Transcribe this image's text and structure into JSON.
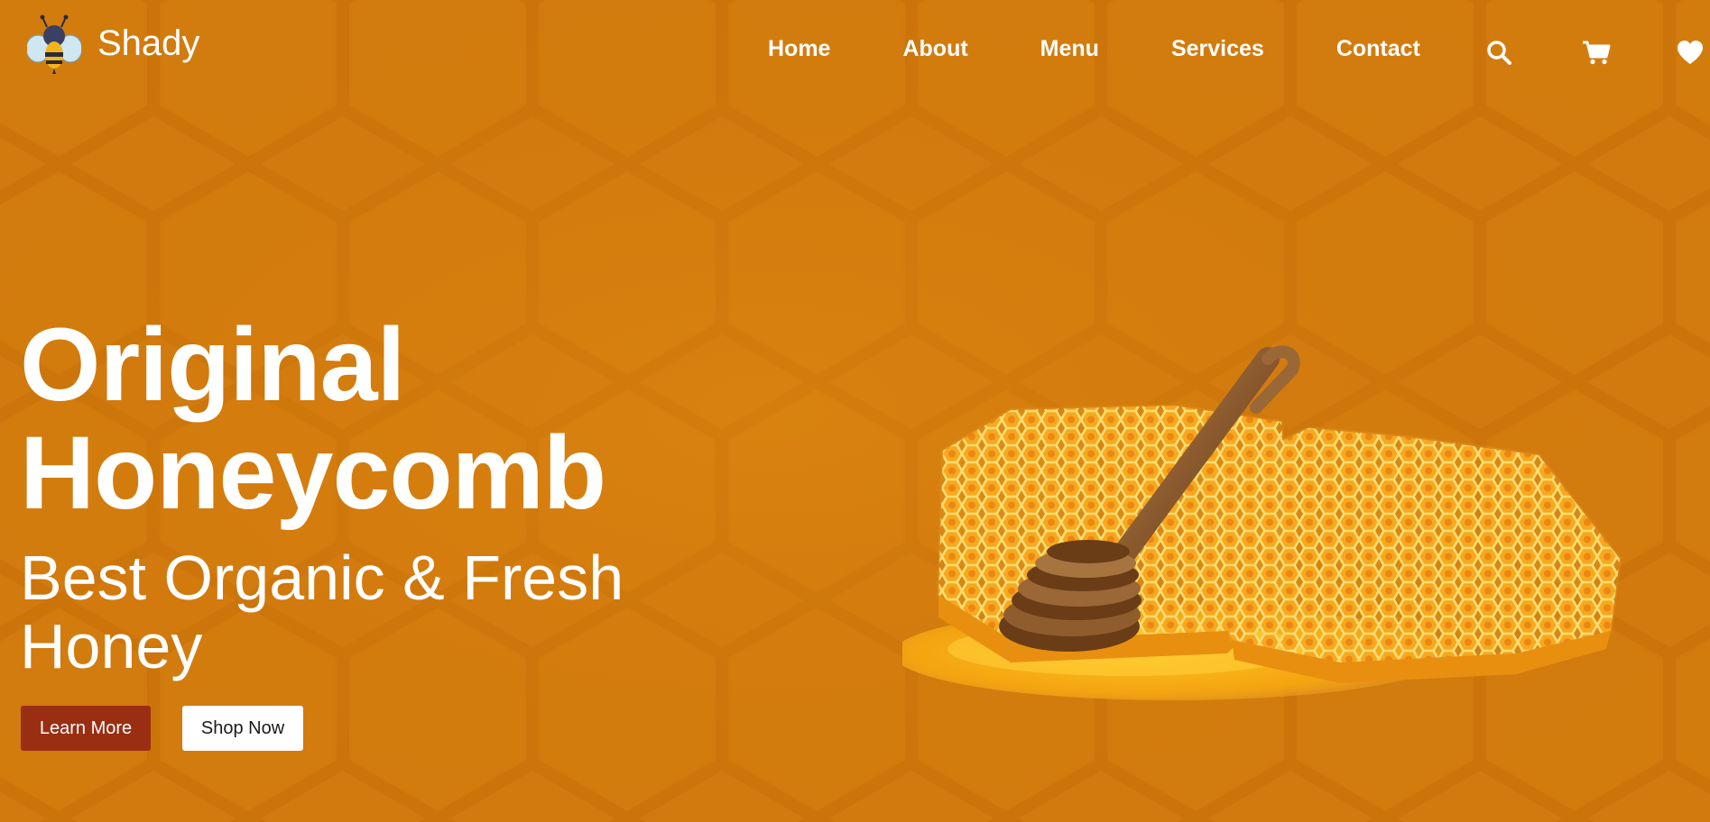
{
  "brand": {
    "name": "Shady",
    "logo_icon": "bee-icon"
  },
  "nav": {
    "items": [
      {
        "label": "Home"
      },
      {
        "label": "About"
      },
      {
        "label": "Menu"
      },
      {
        "label": "Services"
      },
      {
        "label": "Contact"
      }
    ],
    "icons": [
      "search-icon",
      "cart-icon",
      "heart-icon"
    ]
  },
  "hero": {
    "headline_line1": "Original",
    "headline_line2": "Honeycomb",
    "subheadline": "Best Organic & Fresh Honey",
    "learn_more_label": "Learn More",
    "shop_now_label": "Shop Now",
    "image_icon": "honeycomb-with-dipper-icon"
  },
  "colors": {
    "background": "#d27a0e",
    "primary_button": "#9a2e12",
    "secondary_button": "#ffffff",
    "text": "#ffffff"
  }
}
